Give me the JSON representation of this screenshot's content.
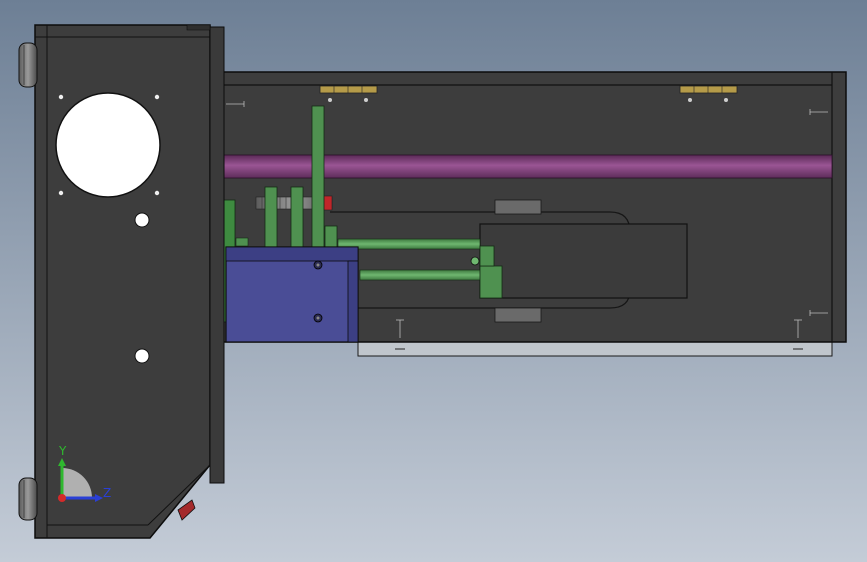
{
  "viewport": {
    "background_top": "#6d7f95",
    "background_bottom": "#c4ccd7"
  },
  "model": {
    "body_color": "#3d3d3d",
    "edge_color": "#0c0c0c",
    "rod_color": "#7e3f78",
    "green_part_color": "#4f9150",
    "block_color": "#4a4d96",
    "knob_color": "#7a7a7a",
    "plate_color": "#c0c6cc"
  },
  "triad": {
    "y_label": "Y",
    "z_label": "Z",
    "y_color": "#2fb82f",
    "z_color": "#2a3fd6",
    "x_color": "#d42a2a"
  }
}
